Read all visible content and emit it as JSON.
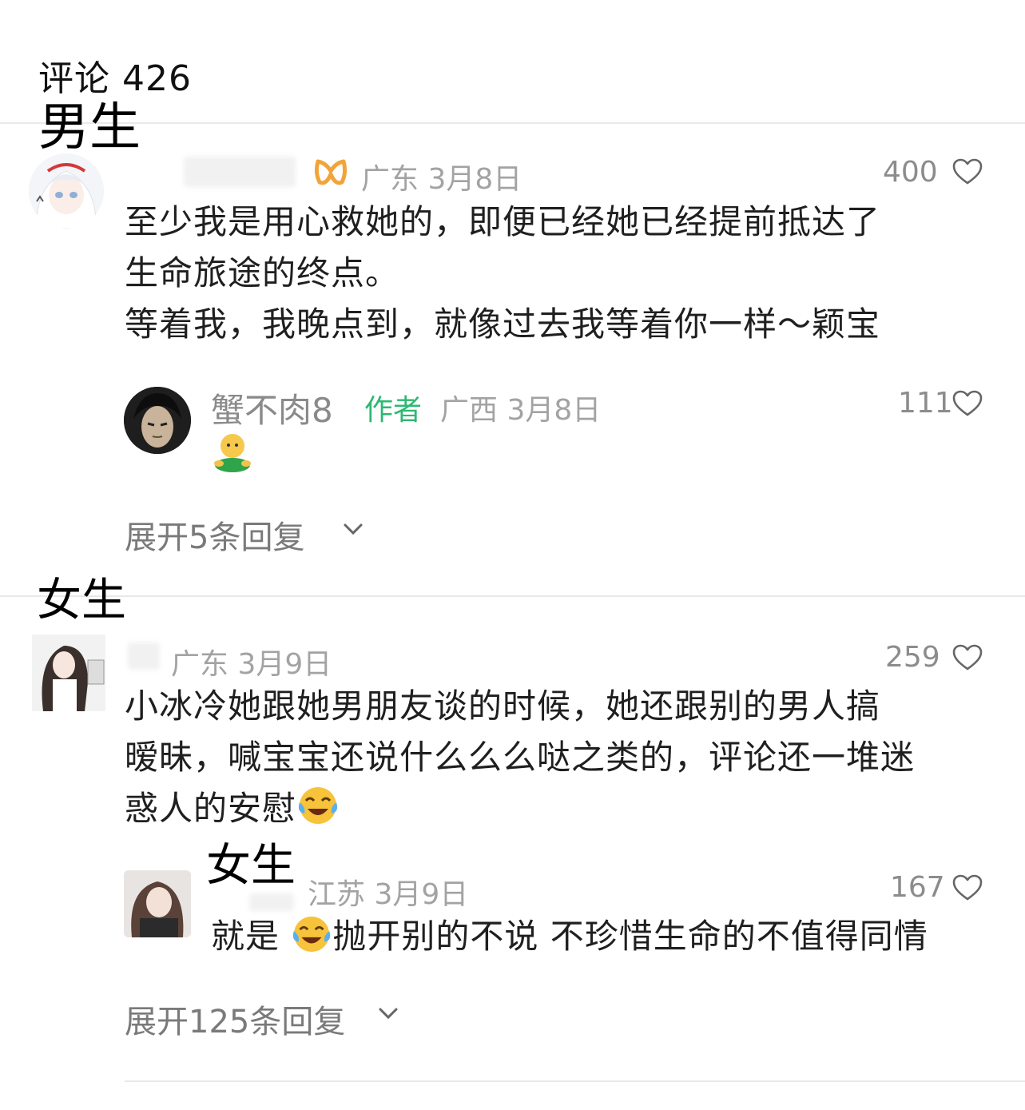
{
  "header": {
    "title": "评论 426"
  },
  "labels": {
    "male": "男生",
    "female": "女生",
    "female_reply": "女生"
  },
  "comment1": {
    "location_date": "广东 3月8日",
    "likes": "400",
    "lines": [
      "至少我是用心救她的，即便已经她已经提前抵达了",
      "生命旅途的终点。",
      "等着我，我晚点到，就像过去我等着你一样～颖宝"
    ],
    "reply": {
      "name": "蟹不肉8",
      "tag": "作者",
      "location_date": "广西 3月8日",
      "likes": "111"
    },
    "expand": "展开5条回复"
  },
  "comment2": {
    "location_date": "广东 3月9日",
    "likes": "259",
    "lines": [
      "小冰冷她跟她男朋友谈的时候，她还跟别的男人搞",
      "暧昧，喊宝宝还说什么么么哒之类的，评论还一堆迷",
      "惑人的安慰"
    ],
    "reply": {
      "location_date": "江苏 3月9日",
      "likes": "167",
      "text_a": "就是 ",
      "text_b": "抛开别的不说 不珍惜生命的不值得同情"
    },
    "expand": "展开125条回复"
  },
  "colors": {
    "author_tag": "#2eb872",
    "meta": "#a3a3a3",
    "separator": "#e9e9e9"
  }
}
